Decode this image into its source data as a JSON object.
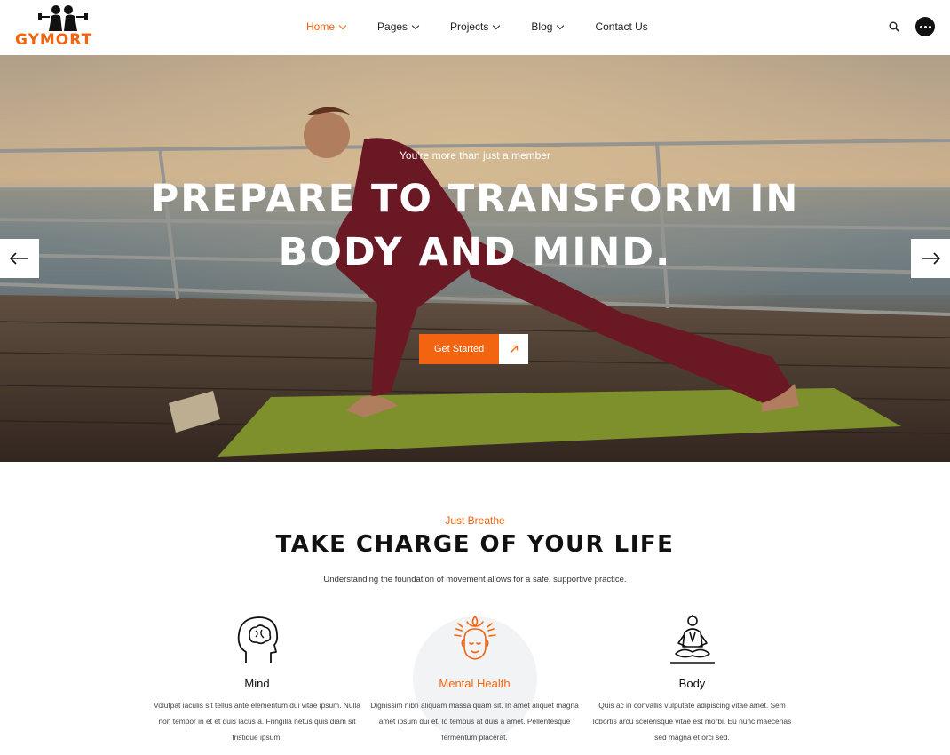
{
  "brand": {
    "name": "GYMORT",
    "accent": "#f2640f"
  },
  "nav": {
    "items": [
      {
        "label": "Home",
        "active": true,
        "has_dropdown": true
      },
      {
        "label": "Pages",
        "active": false,
        "has_dropdown": true
      },
      {
        "label": "Projects",
        "active": false,
        "has_dropdown": true
      },
      {
        "label": "Blog",
        "active": false,
        "has_dropdown": true
      },
      {
        "label": "Contact Us",
        "active": false,
        "has_dropdown": false
      }
    ],
    "icons": [
      "search-icon",
      "more-icon"
    ]
  },
  "hero": {
    "eyebrow": "You're more than just a member",
    "title": "PREPARE TO TRANSFORM IN BODY AND MIND.",
    "cta_label": "Get Started",
    "prev_icon": "arrow-left-icon",
    "next_icon": "arrow-right-icon"
  },
  "intro": {
    "eyebrow": "Just Breathe",
    "title": "TAKE CHARGE OF YOUR LIFE",
    "description": "Understanding the foundation of movement allows for a safe, supportive practice."
  },
  "features": [
    {
      "icon": "brain-head-icon",
      "title": "Mind",
      "text": "Volutpat iaculis sit tellus ante elementum dui vitae ipsum. Nulla non tempor in et et duis lacus a. Fringilla netus quis diam sit tristique ipsum."
    },
    {
      "icon": "meditating-head-icon",
      "title": "Mental Health",
      "text": "Dignissim nibh aliquam massa quam sit. In amet aliquet magna amet ipsum dui et. Id tempus at duis a amet. Pellentesque fermentum placerat.",
      "active": true
    },
    {
      "icon": "meditation-pose-icon",
      "title": "Body",
      "text": "Quis ac in convallis vulputate adipiscing vitae amet. Sem lobortis arcu scelerisque vitae est morbi. Eu nunc maecenas sed magna et orci sed."
    }
  ]
}
